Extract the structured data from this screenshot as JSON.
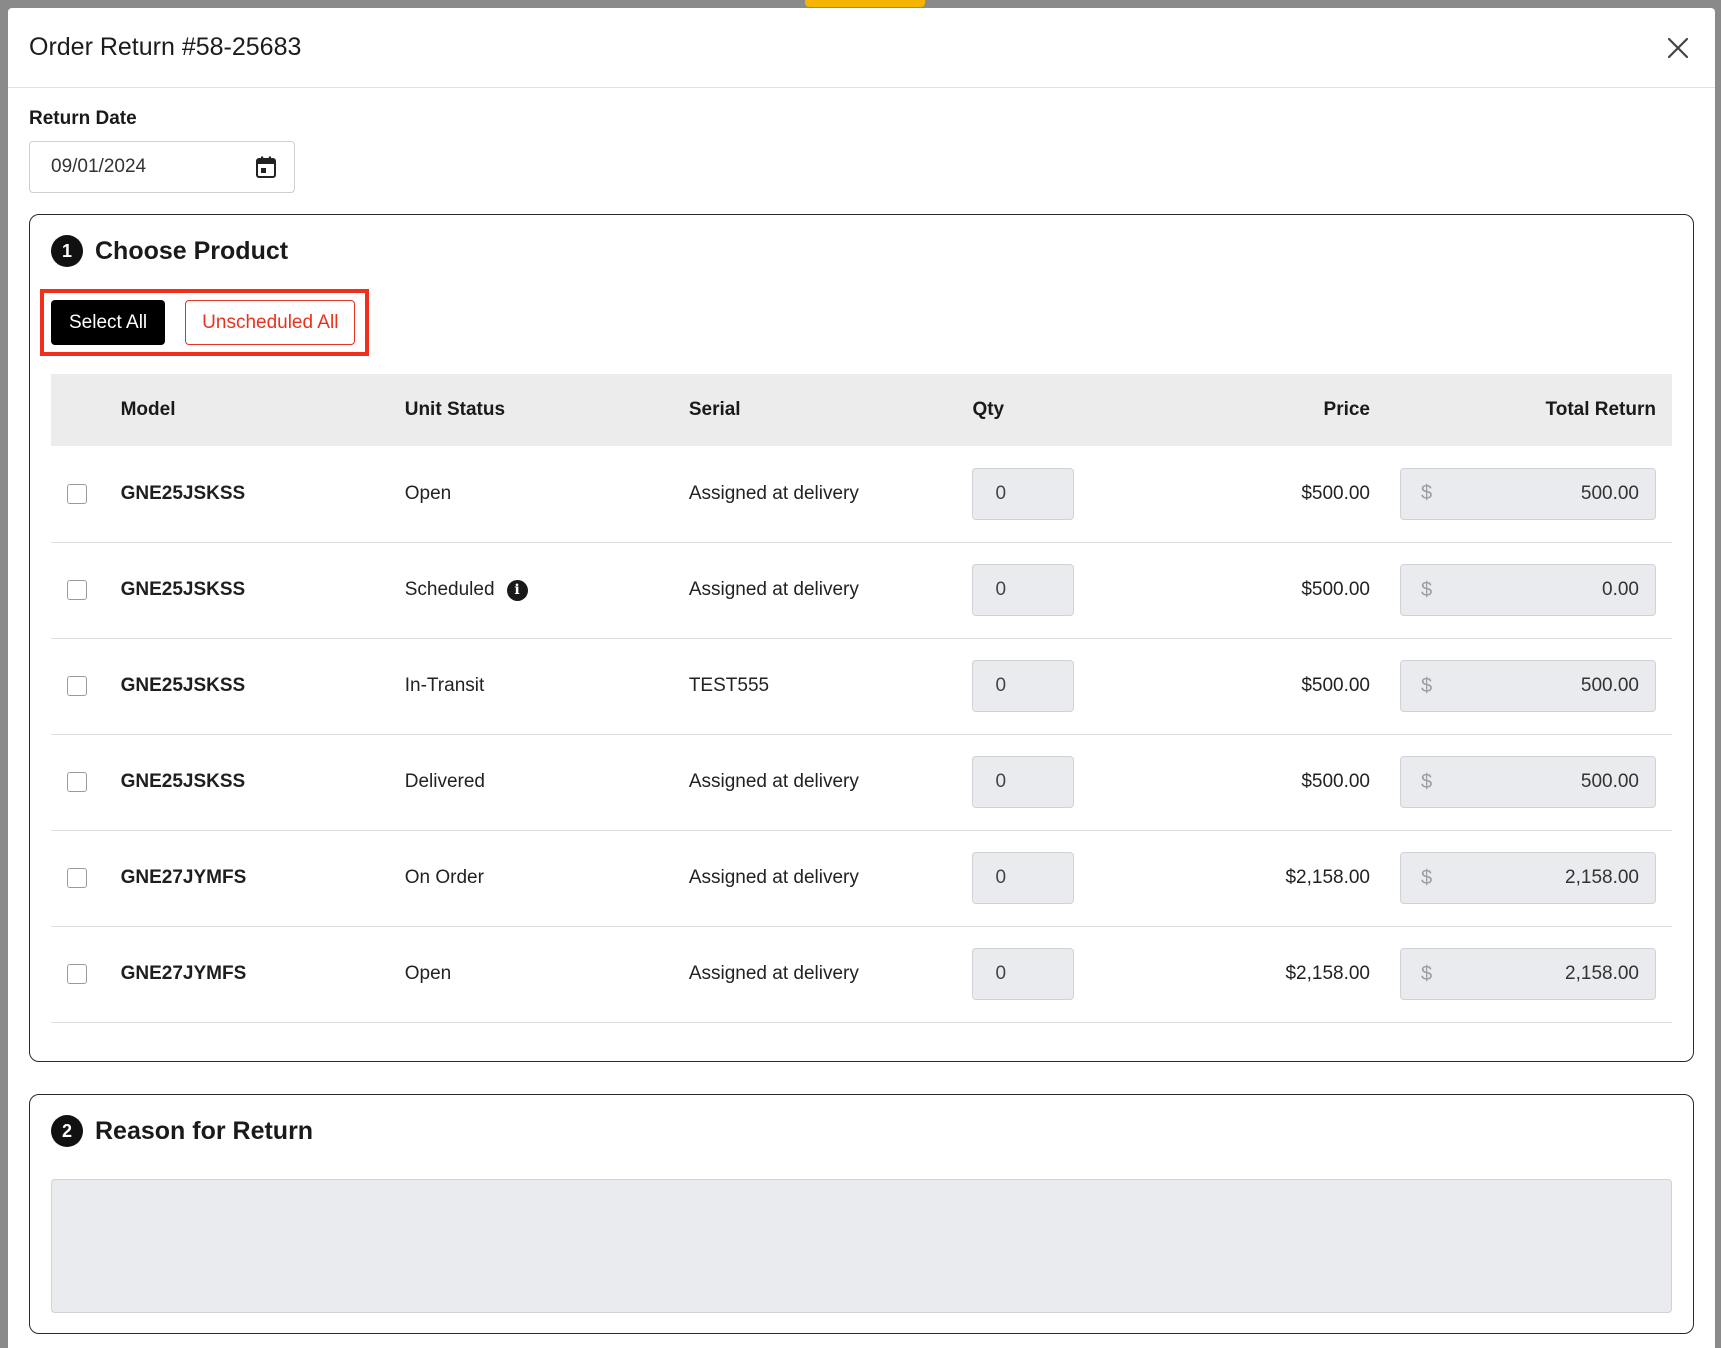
{
  "modal": {
    "title": "Order Return #58-25683"
  },
  "return_date": {
    "label": "Return Date",
    "value": "09/01/2024"
  },
  "choose_product": {
    "step": "1",
    "title": "Choose Product",
    "select_all_label": "Select All",
    "unscheduled_all_label": "Unscheduled All",
    "highlight_color": "#f0301c",
    "columns": [
      "Model",
      "Unit Status",
      "Serial",
      "Qty",
      "Price",
      "Total Return"
    ],
    "rows": [
      {
        "model": "GNE25JSKSS",
        "status": "Open",
        "serial": "Assigned at delivery",
        "qty": "0",
        "price": "$500.00",
        "currency": "$",
        "total": "500.00"
      },
      {
        "model": "GNE25JSKSS",
        "status": "Scheduled",
        "serial": "Assigned at delivery",
        "qty": "0",
        "price": "$500.00",
        "currency": "$",
        "total": "0.00"
      },
      {
        "model": "GNE25JSKSS",
        "status": "In-Transit",
        "serial": "TEST555",
        "qty": "0",
        "price": "$500.00",
        "currency": "$",
        "total": "500.00"
      },
      {
        "model": "GNE25JSKSS",
        "status": "Delivered",
        "serial": "Assigned at delivery",
        "qty": "0",
        "price": "$500.00",
        "currency": "$",
        "total": "500.00"
      },
      {
        "model": "GNE27JYMFS",
        "status": "On Order",
        "serial": "Assigned at delivery",
        "qty": "0",
        "price": "$2,158.00",
        "currency": "$",
        "total": "2,158.00"
      },
      {
        "model": "GNE27JYMFS",
        "status": "Open",
        "serial": "Assigned at delivery",
        "qty": "0",
        "price": "$2,158.00",
        "currency": "$",
        "total": "2,158.00"
      }
    ]
  },
  "reason_for_return": {
    "step": "2",
    "title": "Reason for Return",
    "value": ""
  },
  "icons": {
    "close": "close-icon",
    "calendar": "calendar-icon",
    "info": "info-icon"
  }
}
